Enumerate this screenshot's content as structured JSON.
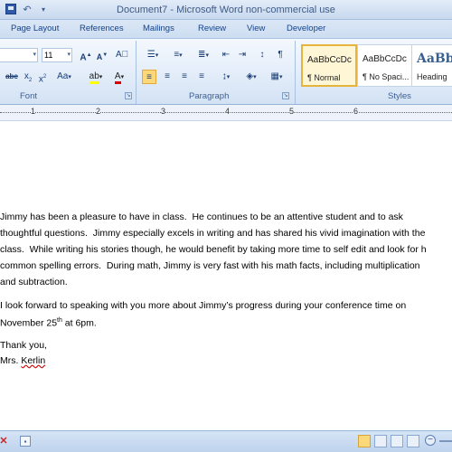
{
  "window": {
    "title": "Document7 - Microsoft Word non-commercial use"
  },
  "tabs": [
    "Page Layout",
    "References",
    "Mailings",
    "Review",
    "View",
    "Developer"
  ],
  "font_group": {
    "font_size": "11",
    "label": "Font",
    "grow_label": "A",
    "shrink_label": "A",
    "case_label": "Aa",
    "strike_label": "abc",
    "subscript_label": "x",
    "superscript_label": "x"
  },
  "paragraph_group": {
    "label": "Paragraph"
  },
  "styles_group": {
    "label": "Styles",
    "styles": [
      {
        "sample": "AaBbCcDc",
        "name": "¶ Normal"
      },
      {
        "sample": "AaBbCcDc",
        "name": "¶ No Spaci..."
      },
      {
        "sample": "AaBbC",
        "name": "Heading"
      }
    ]
  },
  "ruler": {
    "numbers": [
      "1",
      "2",
      "3",
      "4",
      "5",
      "6"
    ]
  },
  "document": {
    "lines_p1": [
      "Jimmy has been a pleasure to have in class.  He continues to be an attentive student and to ask",
      "thoughtful questions.  Jimmy especially excels in writing and has shared his vivid imagination with the",
      "class.  While writing his stories though, he would benefit by taking more time to self edit and look for h",
      "common spelling errors.  During math, Jimmy is very fast with his math facts, including multiplication",
      "and subtraction."
    ],
    "p2_line1": "I look forward to speaking with you more about Jimmy’s progress during your conference time on",
    "p2_line2_pre": "November 25",
    "p2_line2_sup": "th",
    "p2_line2_post": " at 6pm.",
    "closing": "Thank you,",
    "signature_prefix": "Mrs. ",
    "signature_name": "Kerlin"
  },
  "icons": {
    "save": "save-icon",
    "undo": "undo-icon",
    "spelling": "spelling-check-icon"
  }
}
